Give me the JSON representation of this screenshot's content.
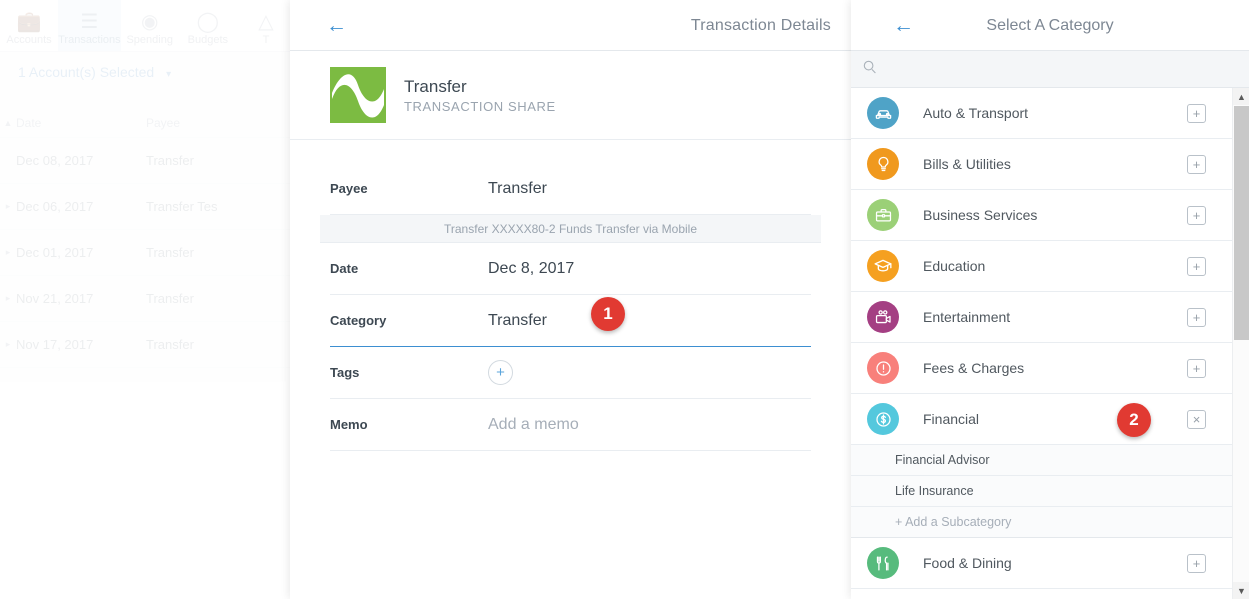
{
  "background_app": {
    "tabs": [
      {
        "label": "Accounts",
        "icon": "wallet-icon",
        "active": false
      },
      {
        "label": "Transactions",
        "icon": "list-icon",
        "active": true
      },
      {
        "label": "Spending",
        "icon": "donut-chart-icon",
        "active": false
      },
      {
        "label": "Budgets",
        "icon": "gauge-icon",
        "active": false
      },
      {
        "label": "T",
        "icon": "trends-icon",
        "active": false
      }
    ],
    "account_selector": "1 Account(s) Selected",
    "table": {
      "columns": [
        "Date",
        "Payee"
      ],
      "rows": [
        {
          "date": "Dec 08, 2017",
          "payee": "Transfer"
        },
        {
          "date": "Dec 06, 2017",
          "payee": "Transfer Tes"
        },
        {
          "date": "Dec 01, 2017",
          "payee": "Transfer"
        },
        {
          "date": "Nov 21, 2017",
          "payee": "Transfer"
        },
        {
          "date": "Nov 17, 2017",
          "payee": "Transfer"
        }
      ]
    }
  },
  "details": {
    "back_label": "←",
    "title": "Transaction Details",
    "merchant_name": "Transfer",
    "merchant_subtitle": "TRANSACTION SHARE",
    "logo_color": "#7cbb42",
    "fields": {
      "payee_label": "Payee",
      "payee_value": "Transfer",
      "payee_description": "Transfer XXXXX80-2 Funds Transfer via Mobile",
      "date_label": "Date",
      "date_value": "Dec 8, 2017",
      "category_label": "Category",
      "category_value": "Transfer",
      "tags_label": "Tags",
      "tags_add": "+",
      "memo_label": "Memo",
      "memo_placeholder": "Add a memo"
    }
  },
  "category_panel": {
    "back_label": "←",
    "title": "Select A Category",
    "search_placeholder": "",
    "search_value": "",
    "search_icon": "search-icon",
    "add_button_label": "+",
    "remove_button_label": "×",
    "categories": [
      {
        "label": "Auto & Transport",
        "icon": "car-icon",
        "color": "#4fa3c7",
        "expanded": false
      },
      {
        "label": "Bills & Utilities",
        "icon": "lightbulb-icon",
        "color": "#f0991e",
        "expanded": false
      },
      {
        "label": "Business Services",
        "icon": "briefcase-icon",
        "color": "#9bd077",
        "expanded": false
      },
      {
        "label": "Education",
        "icon": "graduation-cap-icon",
        "color": "#f5a020",
        "expanded": false
      },
      {
        "label": "Entertainment",
        "icon": "video-camera-icon",
        "color": "#a43f83",
        "expanded": false
      },
      {
        "label": "Fees & Charges",
        "icon": "alert-circle-icon",
        "color": "#f8807b",
        "expanded": false
      },
      {
        "label": "Financial",
        "icon": "dollar-circle-icon",
        "color": "#54c8dd",
        "expanded": true,
        "subcategories": [
          "Financial Advisor",
          "Life Insurance"
        ],
        "add_subcategory_label": "+ Add a Subcategory"
      },
      {
        "label": "Food & Dining",
        "icon": "cutlery-icon",
        "color": "#57bb7d",
        "expanded": false
      }
    ]
  },
  "annotations": [
    {
      "number": "1",
      "color": "#e13a32"
    },
    {
      "number": "2",
      "color": "#e13a32"
    }
  ]
}
